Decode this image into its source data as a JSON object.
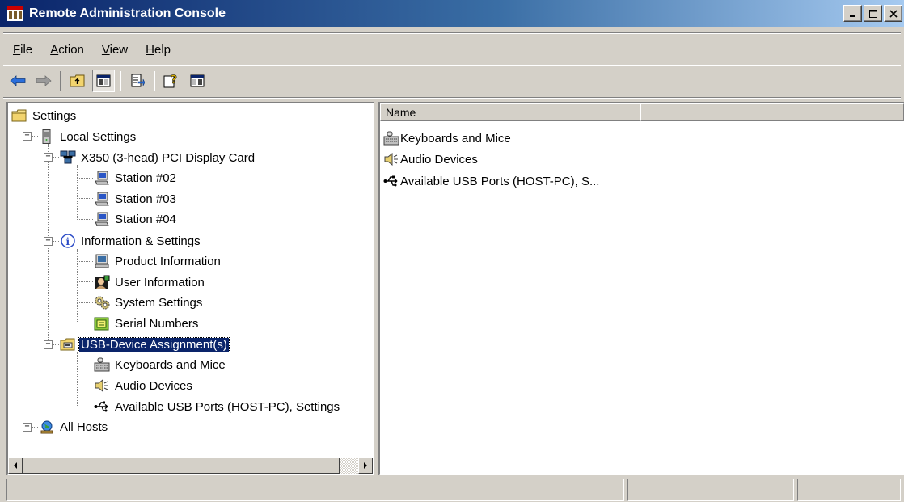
{
  "window": {
    "title": "Remote Administration Console"
  },
  "menu": [
    {
      "label": "File",
      "accel": "F",
      "rest": "ile"
    },
    {
      "label": "Action",
      "accel": "A",
      "rest": "ction"
    },
    {
      "label": "View",
      "accel": "V",
      "rest": "iew"
    },
    {
      "label": "Help",
      "accel": "H",
      "rest": "elp"
    }
  ],
  "tree": {
    "root": "Settings",
    "local_settings": "Local Settings",
    "display_card": "X350 (3-head)  PCI Display Card",
    "stations": [
      "Station #02",
      "Station #03",
      "Station #04"
    ],
    "info_settings": "Information & Settings",
    "info_children": [
      "Product Information",
      "User Information",
      "System Settings",
      "Serial Numbers"
    ],
    "usb_assignment": "USB-Device Assignment(s)",
    "usb_children": [
      "Keyboards and Mice",
      "Audio Devices",
      "Available USB Ports (HOST-PC), Settings"
    ],
    "all_hosts": "All Hosts"
  },
  "list": {
    "column_name": "Name",
    "items": [
      "Keyboards and Mice",
      "Audio Devices",
      "Available USB Ports (HOST-PC), S..."
    ]
  }
}
